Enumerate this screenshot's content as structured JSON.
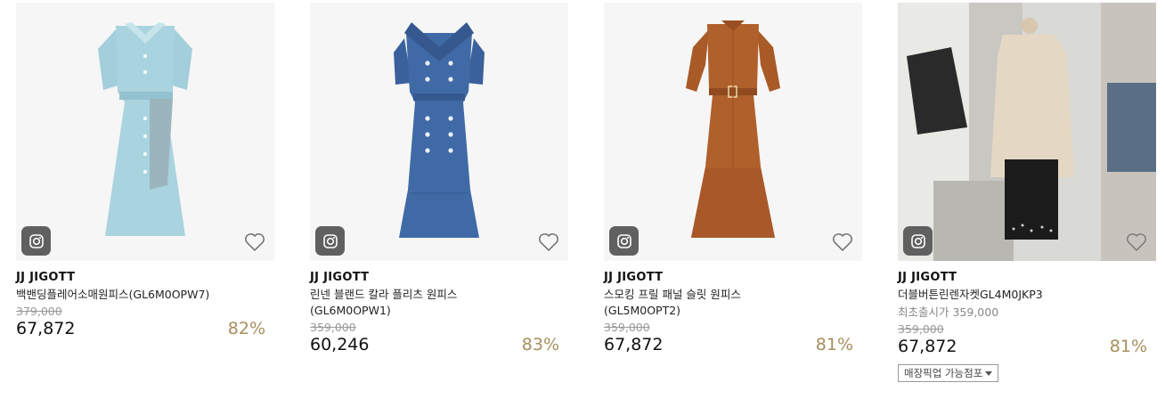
{
  "products": [
    {
      "brand": "JJ JIGOTT",
      "name": "백밴딩플레어소매원피스(GL6M0OPW7)",
      "original_price": "379,000",
      "price": "67,872",
      "discount": "82%",
      "dress_color": "#a9d3df",
      "image_icon": "instagram-icon",
      "wish_icon": "heart-outline-icon"
    },
    {
      "brand": "JJ JIGOTT",
      "name": "린넨 블랜드 칼라 플리츠 원피스(GL6M0OPW1)",
      "original_price": "359,000",
      "price": "60,246",
      "discount": "83%",
      "dress_color": "#3f6aa6",
      "image_icon": "instagram-icon",
      "wish_icon": "heart-outline-icon"
    },
    {
      "brand": "JJ JIGOTT",
      "name": "스모킹 프릴 패널 슬릿 원피스(GL5M0OPT2)",
      "original_price": "359,000",
      "price": "67,872",
      "discount": "81%",
      "dress_color": "#b0602b",
      "image_icon": "instagram-icon",
      "wish_icon": "heart-outline-icon"
    },
    {
      "brand": "JJ JIGOTT",
      "name": "더블버튼린렌자켓GL4M0JKP3",
      "launch_price": "최초출시가 359,000",
      "original_price": "359,000",
      "price": "67,872",
      "discount": "81%",
      "pickup_label": "매장픽업 가능점포",
      "image_icon": "instagram-icon",
      "wish_icon": "heart-outline-icon"
    }
  ]
}
